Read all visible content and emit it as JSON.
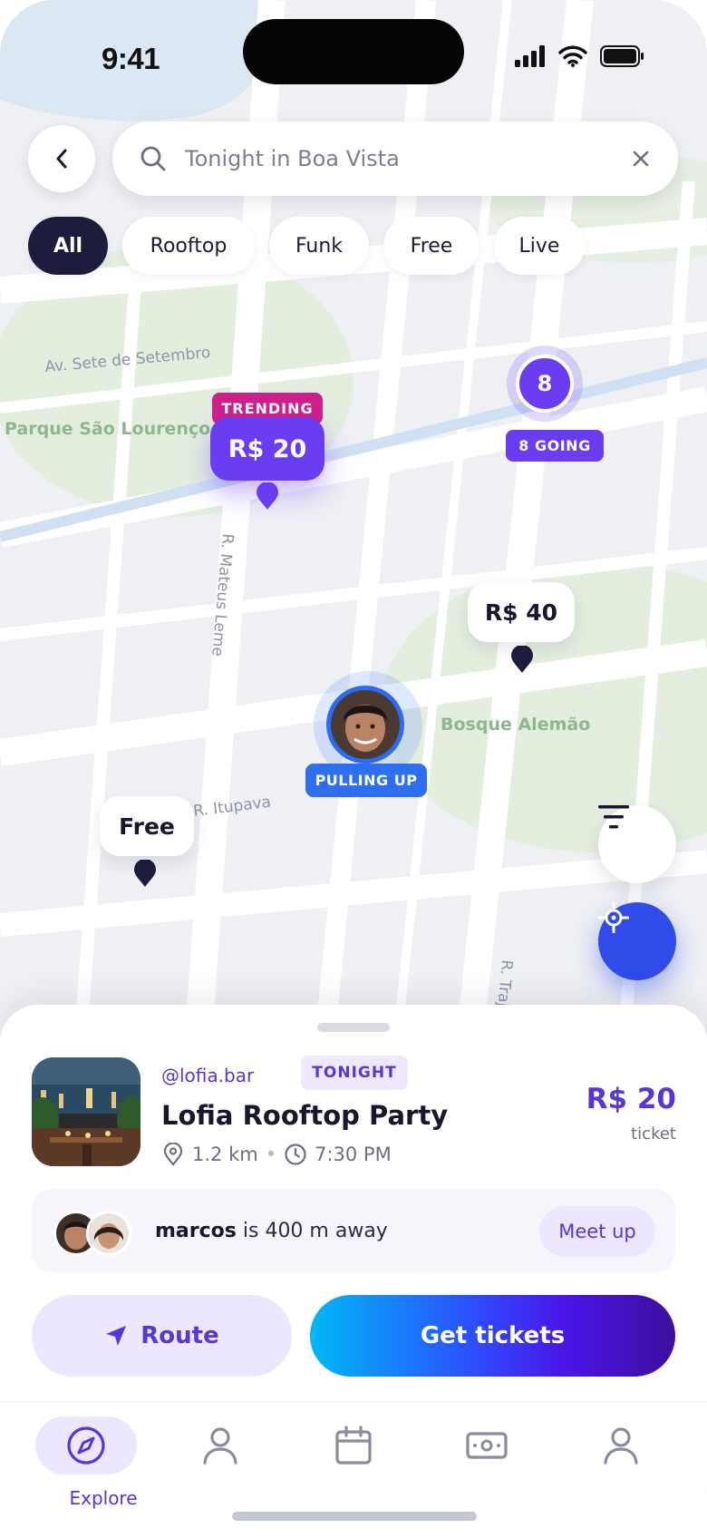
{
  "status_bar": {
    "time": "9:41"
  },
  "search": {
    "placeholder": "Tonight in Boa Vista"
  },
  "filters": {
    "chips": [
      {
        "label": "All",
        "active": true
      },
      {
        "label": "Rooftop",
        "active": false
      },
      {
        "label": "Funk",
        "active": false
      },
      {
        "label": "Free",
        "active": false
      },
      {
        "label": "Live",
        "active": false
      }
    ]
  },
  "map": {
    "streets": {
      "sete_setembro": "Av. Sete de Setembro",
      "mateus_leme": "R. Mateus Leme",
      "itupava": "R. Itupava",
      "traj": "R. Traj"
    },
    "parks": {
      "sao_lourenco": "Parque São Lourenço",
      "bosque_alemao": "Bosque Alemão"
    },
    "markers": {
      "trending_tag": "TRENDING",
      "trending_price": "R$ 20",
      "cluster_count": "8",
      "going_tag": "8 GOING",
      "price_40": "R$ 40",
      "free": "Free",
      "pulling_up": "PULLING UP"
    }
  },
  "event": {
    "handle": "@lofia.bar",
    "tag": "TONIGHT",
    "title": "Lofia Rooftop Party",
    "distance": "1.2 km",
    "time": "7:30 PM",
    "price": "R$ 20",
    "price_sub": "ticket"
  },
  "friend": {
    "name": "marcos",
    "text": "is 400 m away",
    "action": "Meet up"
  },
  "actions": {
    "route": "Route",
    "tickets": "Get tickets"
  },
  "tabbar": {
    "active_label": "Explore",
    "tabs": [
      "explore-icon",
      "profile-icon",
      "calendar-icon",
      "ticket-icon",
      "account-icon"
    ]
  },
  "colors": {
    "accent": "#6a3df2",
    "trending": "#cf1f8b",
    "friend_blue": "#2e6ff2",
    "dark_chip": "#1d1c3d"
  }
}
